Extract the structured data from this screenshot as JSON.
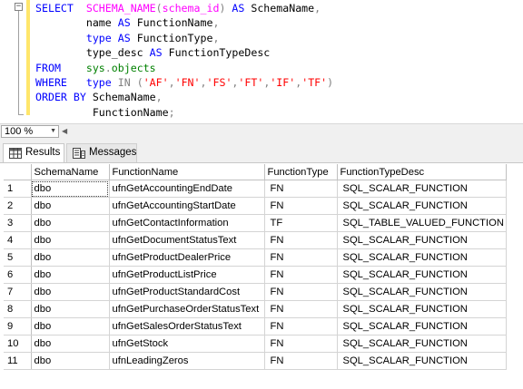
{
  "editor": {
    "collapse_glyph": "−",
    "lines": [
      [
        {
          "t": "SELECT  ",
          "c": "kw"
        },
        {
          "t": "SCHEMA_NAME",
          "c": "fn"
        },
        {
          "t": "(",
          "c": "op"
        },
        {
          "t": "schema_id",
          "c": "fn"
        },
        {
          "t": ")",
          "c": "op"
        },
        {
          "t": " AS ",
          "c": "kw"
        },
        {
          "t": "SchemaName",
          "c": "txt"
        },
        {
          "t": ",",
          "c": "op"
        }
      ],
      [
        {
          "t": "        name ",
          "c": "txt"
        },
        {
          "t": "AS ",
          "c": "kw"
        },
        {
          "t": "FunctionName",
          "c": "txt"
        },
        {
          "t": ",",
          "c": "op"
        }
      ],
      [
        {
          "t": "        type ",
          "c": "kw"
        },
        {
          "t": "AS ",
          "c": "kw"
        },
        {
          "t": "FunctionType",
          "c": "txt"
        },
        {
          "t": ",",
          "c": "op"
        }
      ],
      [
        {
          "t": "        type_desc ",
          "c": "txt"
        },
        {
          "t": "AS ",
          "c": "kw"
        },
        {
          "t": "FunctionTypeDesc",
          "c": "txt"
        }
      ],
      [
        {
          "t": "FROM    ",
          "c": "kw"
        },
        {
          "t": "sys",
          "c": "sys"
        },
        {
          "t": ".",
          "c": "op"
        },
        {
          "t": "objects",
          "c": "sys"
        }
      ],
      [
        {
          "t": "WHERE   ",
          "c": "kw"
        },
        {
          "t": "type ",
          "c": "kw"
        },
        {
          "t": "IN ",
          "c": "op"
        },
        {
          "t": "(",
          "c": "op"
        },
        {
          "t": "'AF'",
          "c": "str"
        },
        {
          "t": ",",
          "c": "op"
        },
        {
          "t": "'FN'",
          "c": "str"
        },
        {
          "t": ",",
          "c": "op"
        },
        {
          "t": "'FS'",
          "c": "str"
        },
        {
          "t": ",",
          "c": "op"
        },
        {
          "t": "'FT'",
          "c": "str"
        },
        {
          "t": ",",
          "c": "op"
        },
        {
          "t": "'IF'",
          "c": "str"
        },
        {
          "t": ",",
          "c": "op"
        },
        {
          "t": "'TF'",
          "c": "str"
        },
        {
          "t": ")",
          "c": "op"
        }
      ],
      [
        {
          "t": "ORDER BY ",
          "c": "kw"
        },
        {
          "t": "SchemaName",
          "c": "txt"
        },
        {
          "t": ",",
          "c": "op"
        }
      ],
      [
        {
          "t": "         FunctionName",
          "c": "txt"
        },
        {
          "t": ";",
          "c": "op"
        }
      ]
    ]
  },
  "zoom": {
    "value": "100 %",
    "arrow": "▼",
    "scroll_left": "◀"
  },
  "tabs": {
    "results_label": "Results",
    "messages_label": "Messages"
  },
  "grid": {
    "columns": [
      "",
      "SchemaName",
      "FunctionName",
      "FunctionType",
      "FunctionTypeDesc"
    ],
    "rows": [
      [
        "1",
        "dbo",
        "ufnGetAccountingEndDate",
        "FN",
        "SQL_SCALAR_FUNCTION"
      ],
      [
        "2",
        "dbo",
        "ufnGetAccountingStartDate",
        "FN",
        "SQL_SCALAR_FUNCTION"
      ],
      [
        "3",
        "dbo",
        "ufnGetContactInformation",
        "TF",
        "SQL_TABLE_VALUED_FUNCTION"
      ],
      [
        "4",
        "dbo",
        "ufnGetDocumentStatusText",
        "FN",
        "SQL_SCALAR_FUNCTION"
      ],
      [
        "5",
        "dbo",
        "ufnGetProductDealerPrice",
        "FN",
        "SQL_SCALAR_FUNCTION"
      ],
      [
        "6",
        "dbo",
        "ufnGetProductListPrice",
        "FN",
        "SQL_SCALAR_FUNCTION"
      ],
      [
        "7",
        "dbo",
        "ufnGetProductStandardCost",
        "FN",
        "SQL_SCALAR_FUNCTION"
      ],
      [
        "8",
        "dbo",
        "ufnGetPurchaseOrderStatusText",
        "FN",
        "SQL_SCALAR_FUNCTION"
      ],
      [
        "9",
        "dbo",
        "ufnGetSalesOrderStatusText",
        "FN",
        "SQL_SCALAR_FUNCTION"
      ],
      [
        "10",
        "dbo",
        "ufnGetStock",
        "FN",
        "SQL_SCALAR_FUNCTION"
      ],
      [
        "11",
        "dbo",
        "ufnLeadingZeros",
        "FN",
        "SQL_SCALAR_FUNCTION"
      ]
    ]
  },
  "colors": {
    "keyword": "#0000ff",
    "function": "#ff00ff",
    "system_object": "#008000",
    "string": "#ff0000",
    "operator": "#808080",
    "change_bar": "#ffe66b"
  }
}
